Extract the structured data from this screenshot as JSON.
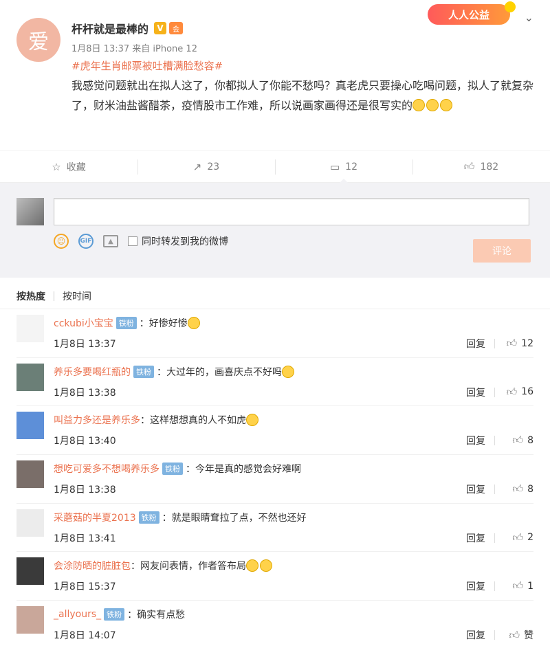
{
  "post": {
    "avatar_char": "爱",
    "author": "杆杆就是最棒的",
    "v_badge": "V",
    "member_badge": "会",
    "public_badge": "人人公益",
    "meta": "1月8日 13:37 来自 iPhone 12",
    "topic": "#虎年生肖邮票被吐槽满脸愁容#",
    "text": "我感觉问题就出在拟人这了，你都拟人了你能不愁吗？真老虎只要操心吃喝问题，拟人了就复杂了，财米油盐酱醋茶，疫情股市工作难，所以说画家画得还是很写实的"
  },
  "actions": {
    "favorite": "收藏",
    "repost": "23",
    "comment": "12",
    "like": "182"
  },
  "compose": {
    "repost_label": "同时转发到我的微博",
    "submit": "评论",
    "gif_label": "GIF"
  },
  "sort": {
    "hot": "按热度",
    "time": "按时间"
  },
  "comments": [
    {
      "user": "cckubi小宝宝",
      "badge": "铁粉",
      "text": "：好惨好惨",
      "emoji": 1,
      "time": "1月8日 13:37",
      "reply": "回复",
      "likes": "12",
      "avatar_color": "#f4f4f4"
    },
    {
      "user": "养乐多要喝红瓶的",
      "badge": "铁粉",
      "text": "：大过年的，画喜庆点不好吗",
      "emoji": 1,
      "time": "1月8日 13:38",
      "reply": "回复",
      "likes": "16",
      "avatar_color": "#6b7f77"
    },
    {
      "user": "叫益力多还是养乐多",
      "badge": "",
      "text": "：这样想想真的人不如虎",
      "emoji": 1,
      "time": "1月8日 13:40",
      "reply": "回复",
      "likes": "8",
      "avatar_color": "#5d8fd8"
    },
    {
      "user": "想吃可爱多不想喝养乐多",
      "badge": "铁粉",
      "text": "：今年是真的感觉会好难啊",
      "emoji": 0,
      "time": "1月8日 13:38",
      "reply": "回复",
      "likes": "8",
      "avatar_color": "#7a6e69"
    },
    {
      "user": "采蘑菇的半夏2013",
      "badge": "铁粉",
      "text": "：就是眼睛耷拉了点，不然也还好",
      "emoji": 0,
      "time": "1月8日 13:41",
      "reply": "回复",
      "likes": "2",
      "avatar_color": "#ececec"
    },
    {
      "user": "会涂防晒的脏脏包",
      "badge": "",
      "text": "：网友问表情，作者答布局",
      "emoji": 2,
      "time": "1月8日 15:37",
      "reply": "回复",
      "likes": "1",
      "avatar_color": "#3a3a3a"
    },
    {
      "user": "_allyours_",
      "badge": "铁粉",
      "text": "：确实有点愁",
      "emoji": 0,
      "time": "1月8日 14:07",
      "reply": "回复",
      "likes": "赞",
      "avatar_color": "#c9a79a"
    }
  ]
}
